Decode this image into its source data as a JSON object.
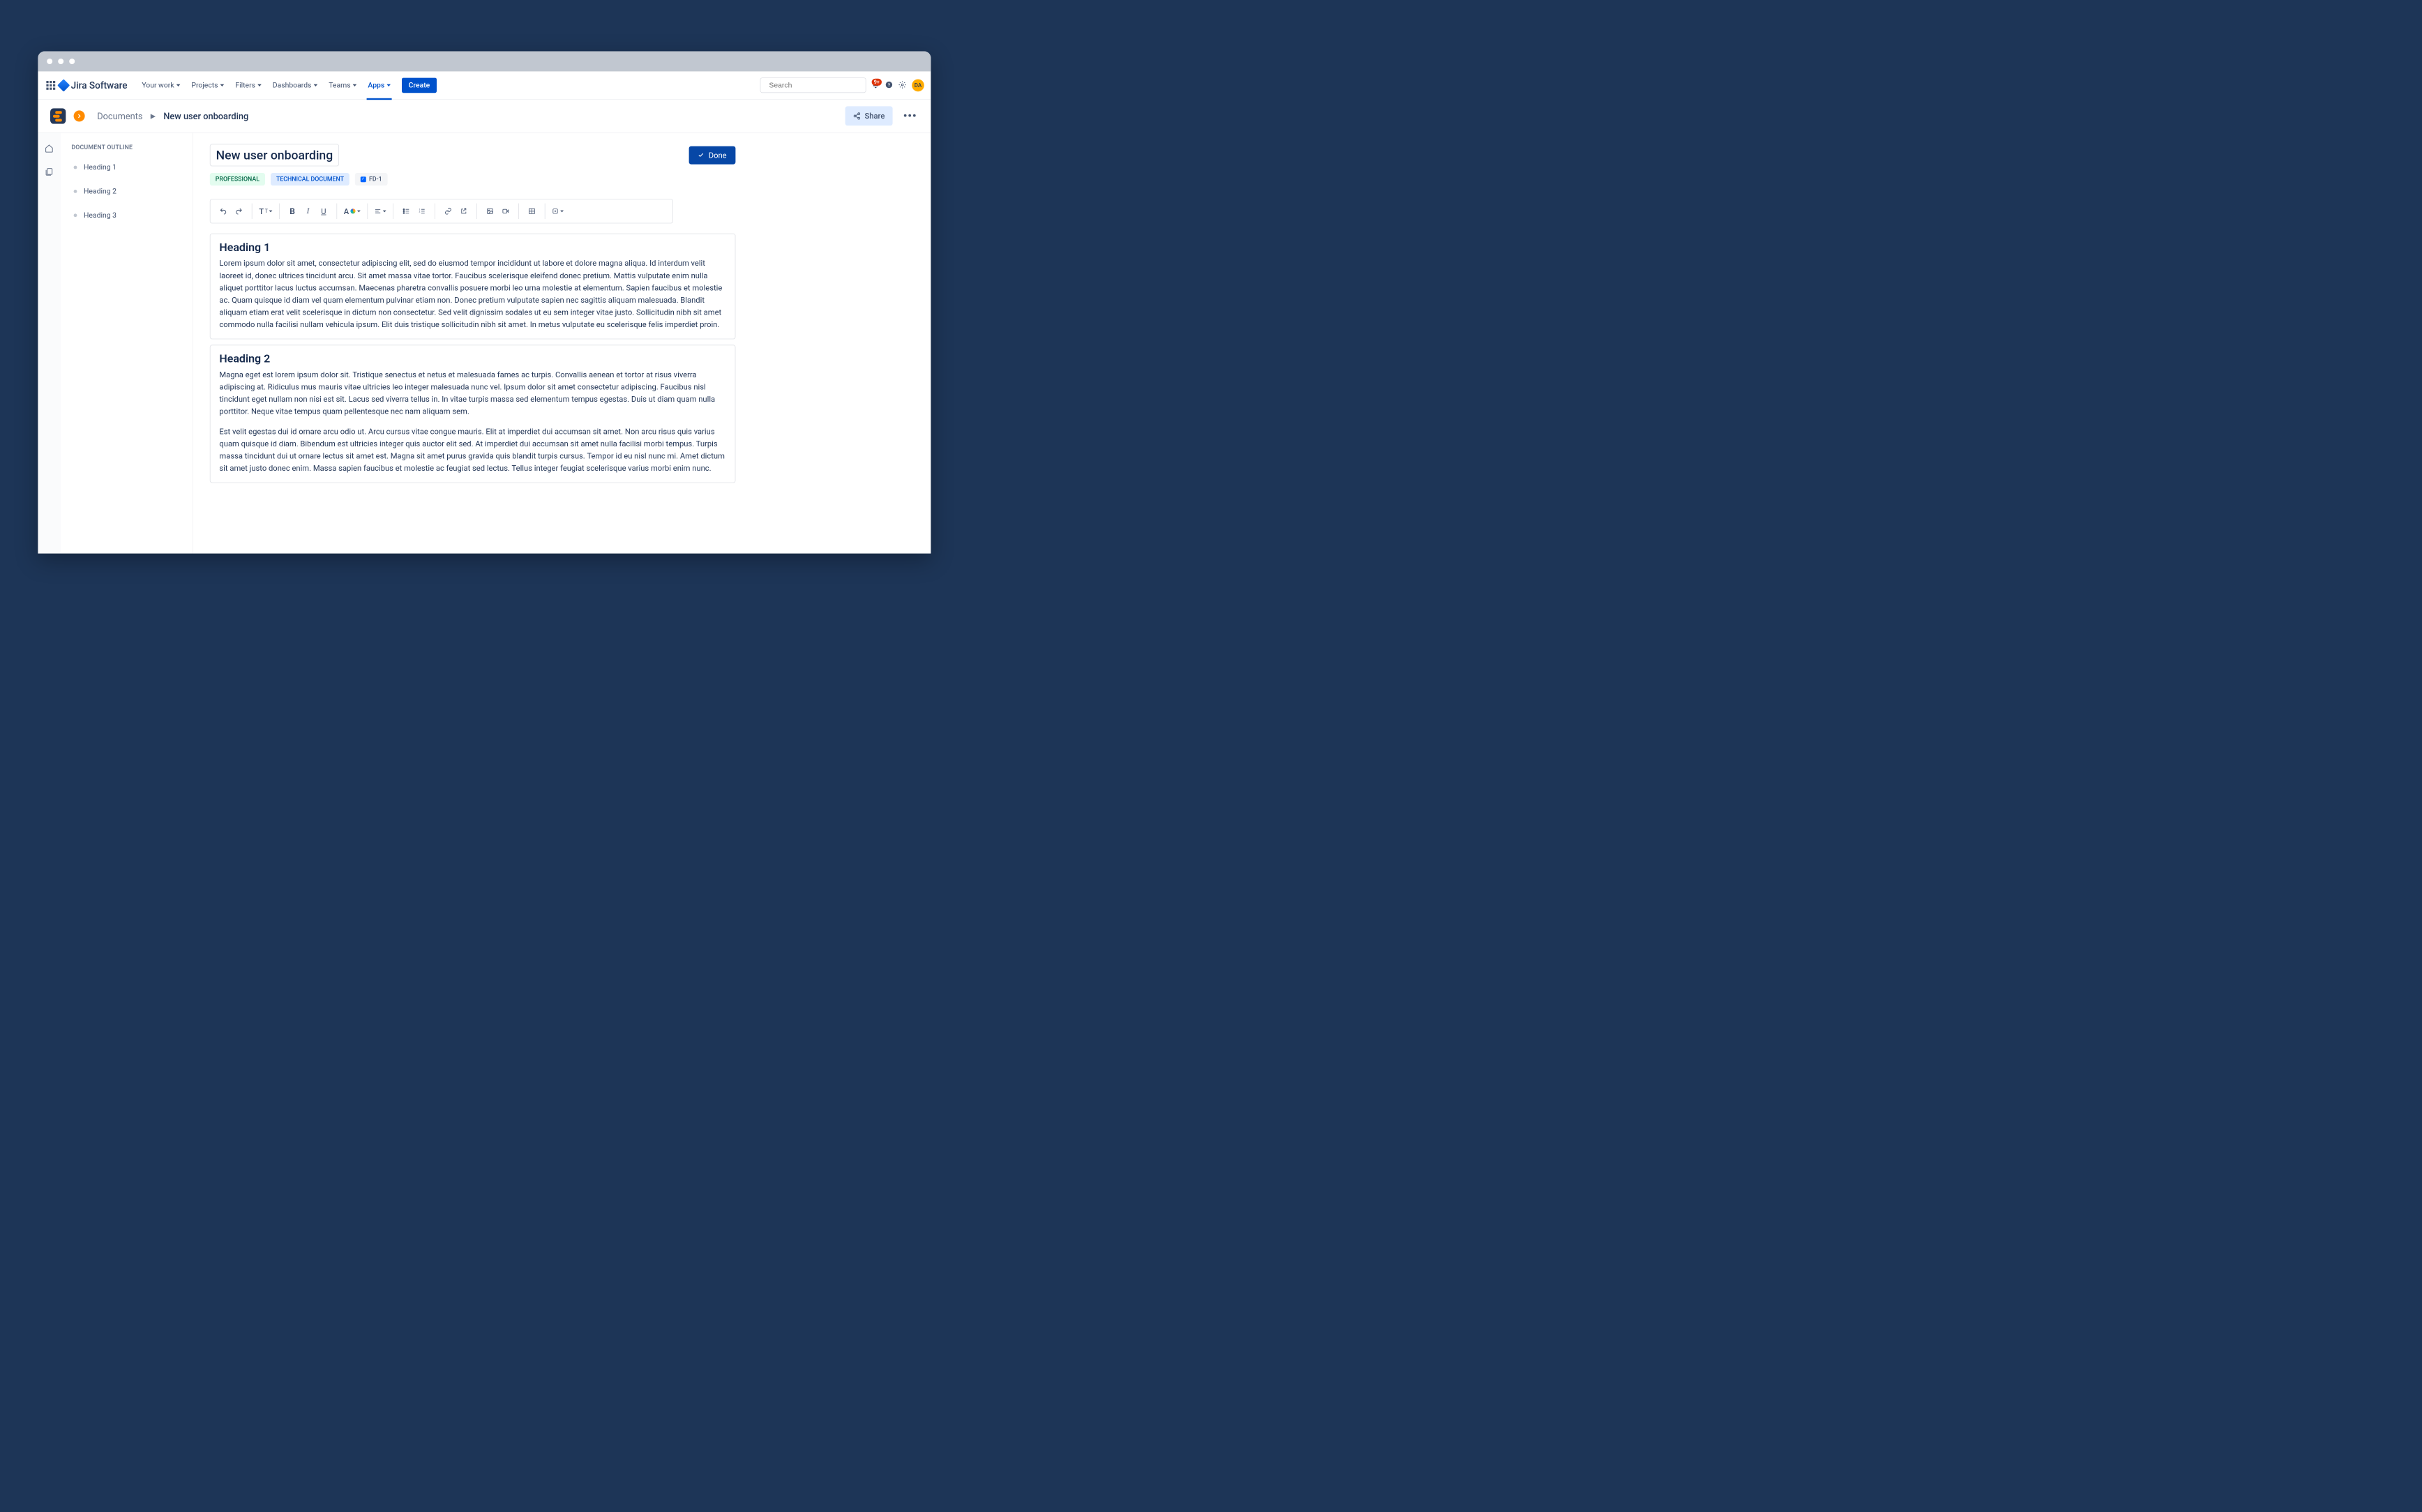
{
  "app": {
    "name": "Jira Software"
  },
  "nav": {
    "items": [
      {
        "label": "Your work"
      },
      {
        "label": "Projects"
      },
      {
        "label": "Filters"
      },
      {
        "label": "Dashboards"
      },
      {
        "label": "Teams"
      },
      {
        "label": "Apps"
      }
    ],
    "create": "Create",
    "search_placeholder": "Search",
    "notif_count": "9+",
    "avatar_initials": "DA"
  },
  "breadcrumb": {
    "parent": "Documents",
    "current": "New user onboarding"
  },
  "actions": {
    "share": "Share",
    "done": "Done"
  },
  "outline": {
    "title": "DOCUMENT OUTLINE",
    "items": [
      "Heading 1",
      "Heading 2",
      "Heading 3"
    ]
  },
  "doc": {
    "title": "New user onboarding",
    "tags": [
      {
        "label": "PROFESSIONAL",
        "style": "green"
      },
      {
        "label": "TECHNICAL DOCUMENT",
        "style": "blue"
      },
      {
        "label": "FD-1",
        "style": "light",
        "check": true
      }
    ],
    "blocks": [
      {
        "heading": "Heading 1",
        "paragraphs": [
          "Lorem ipsum dolor sit amet, consectetur adipiscing elit, sed do eiusmod tempor incididunt ut labore et dolore magna aliqua. Id interdum velit laoreet id, donec ultrices tincidunt arcu. Sit amet massa vitae tortor. Faucibus scelerisque eleifend donec pretium. Mattis vulputate enim nulla aliquet porttitor lacus luctus accumsan. Maecenas pharetra convallis posuere morbi leo urna molestie at elementum. Sapien faucibus et molestie ac. Quam quisque id diam vel quam elementum pulvinar etiam non. Donec pretium vulputate sapien nec sagittis aliquam malesuada. Blandit aliquam etiam erat velit scelerisque in dictum non consectetur. Sed velit dignissim sodales ut eu sem integer vitae justo. Sollicitudin nibh sit amet commodo nulla facilisi nullam vehicula ipsum. Elit duis tristique sollicitudin nibh sit amet. In metus vulputate eu scelerisque felis imperdiet proin."
        ]
      },
      {
        "heading": "Heading 2",
        "paragraphs": [
          "Magna eget est lorem ipsum dolor sit. Tristique senectus et netus et malesuada fames ac turpis. Convallis aenean et tortor at risus viverra adipiscing at. Ridiculus mus mauris vitae ultricies leo integer malesuada nunc vel. Ipsum dolor sit amet consectetur adipiscing. Faucibus nisl tincidunt eget nullam non nisi est sit. Lacus sed viverra tellus in. In vitae turpis massa sed elementum tempus egestas. Duis ut diam quam nulla porttitor. Neque vitae tempus quam pellentesque nec nam aliquam sem.",
          "Est velit egestas dui id ornare arcu odio ut. Arcu cursus vitae congue mauris. Elit at imperdiet dui accumsan sit amet. Non arcu risus quis varius quam quisque id diam. Bibendum est ultricies integer quis auctor elit sed. At imperdiet dui accumsan sit amet nulla facilisi morbi tempus. Turpis massa tincidunt dui ut ornare lectus sit amet est. Magna sit amet purus gravida quis blandit turpis cursus. Tempor id eu nisl nunc mi. Amet dictum sit amet justo donec enim. Massa sapien faucibus et molestie ac feugiat sed lectus. Tellus integer feugiat scelerisque varius morbi enim nunc."
        ]
      }
    ]
  }
}
